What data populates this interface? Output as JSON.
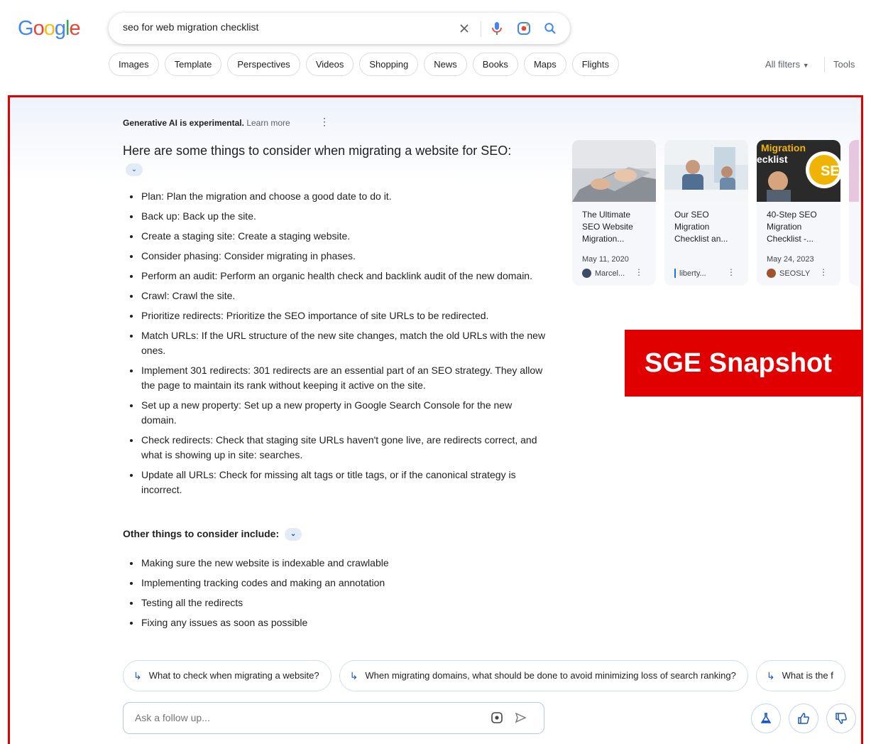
{
  "header": {
    "logo_letters": [
      "G",
      "o",
      "o",
      "g",
      "l",
      "e"
    ],
    "logo_colors": [
      "#4285F4",
      "#EA4335",
      "#FBBC05",
      "#4285F4",
      "#34A853",
      "#EA4335"
    ],
    "search_query": "seo for web migration checklist",
    "chips": [
      "Images",
      "Template",
      "Perspectives",
      "Videos",
      "Shopping",
      "News",
      "Books",
      "Maps",
      "Flights"
    ],
    "all_filters": "All filters",
    "tools": "Tools"
  },
  "sge": {
    "notice_bold": "Generative AI is experimental.",
    "notice_link": "Learn more",
    "heading": "Here are some things to consider when migrating a website for SEO:",
    "items": [
      "Plan: Plan the migration and choose a good date to do it.",
      "Back up: Back up the site.",
      "Create a staging site: Create a staging website.",
      "Consider phasing: Consider migrating in phases.",
      "Perform an audit: Perform an organic health check and backlink audit of the new domain.",
      "Crawl: Crawl the site.",
      "Prioritize redirects: Prioritize the SEO importance of site URLs to be redirected.",
      "Match URLs: If the URL structure of the new site changes, match the old URLs with the new ones.",
      "Implement 301 redirects: 301 redirects are an essential part of an SEO strategy. They allow the page to maintain its rank without keeping it active on the site.",
      "Set up a new property: Set up a new property in Google Search Console for the new domain.",
      "Check redirects: Check that staging site URLs haven't gone live, are redirects correct, and what is showing up in site: searches.",
      "Update all URLs: Check for missing alt tags or title tags, or if the canonical strategy is incorrect."
    ],
    "other_heading": "Other things to consider include:",
    "other_items": [
      "Making sure the new website is indexable and crawlable",
      "Implementing tracking codes and making an annotation",
      "Testing all the redirects",
      "Fixing any issues as soon as possible"
    ],
    "cards": [
      {
        "title": "The Ultimate SEO Website Migration...",
        "date": "May 11, 2020",
        "source": "Marcel..."
      },
      {
        "title": "Our SEO Migration Checklist an...",
        "date": "",
        "source": "liberty..."
      },
      {
        "title": "40-Step SEO Migration Checklist -...",
        "date": "May 24, 2023",
        "source": "SEOSLY"
      }
    ],
    "card3_thumb_text_1": "Migration",
    "card3_thumb_text_2": "ecklist",
    "card3_thumb_text_3": "SE",
    "badge": "SGE Snapshot",
    "followups": [
      "What to check when migrating a website?",
      "When migrating domains, what should be done to avoid minimizing loss of search ranking?",
      "What is the f"
    ],
    "ask_placeholder": "Ask a follow up..."
  }
}
